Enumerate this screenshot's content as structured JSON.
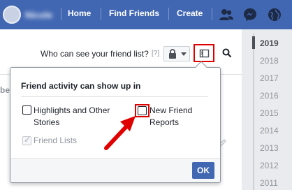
{
  "topbar": {
    "profile_name": "Nicole",
    "links": [
      "Home",
      "Find Friends",
      "Create"
    ],
    "icons": [
      "friends-icon",
      "messenger-icon",
      "notifications-globe-icon"
    ],
    "bg_color": "#4267b2"
  },
  "header": {
    "who_label": "Who can see your friend list?",
    "help": "[?]"
  },
  "card": {
    "partial_tab": "be"
  },
  "popup": {
    "title": "Friend activity can show up in",
    "options": [
      {
        "label": "Highlights and Other Stories",
        "checked": false,
        "disabled": false
      },
      {
        "label": "New Friend Reports",
        "checked": false,
        "disabled": false
      },
      {
        "label": "Friend Lists",
        "checked": true,
        "disabled": true
      }
    ],
    "ok_label": "OK"
  },
  "years": [
    "2019",
    "2018",
    "2017",
    "2016",
    "2015",
    "2014",
    "2013",
    "2012",
    "2011"
  ],
  "active_year": "2019",
  "highlight_color": "#e00000"
}
